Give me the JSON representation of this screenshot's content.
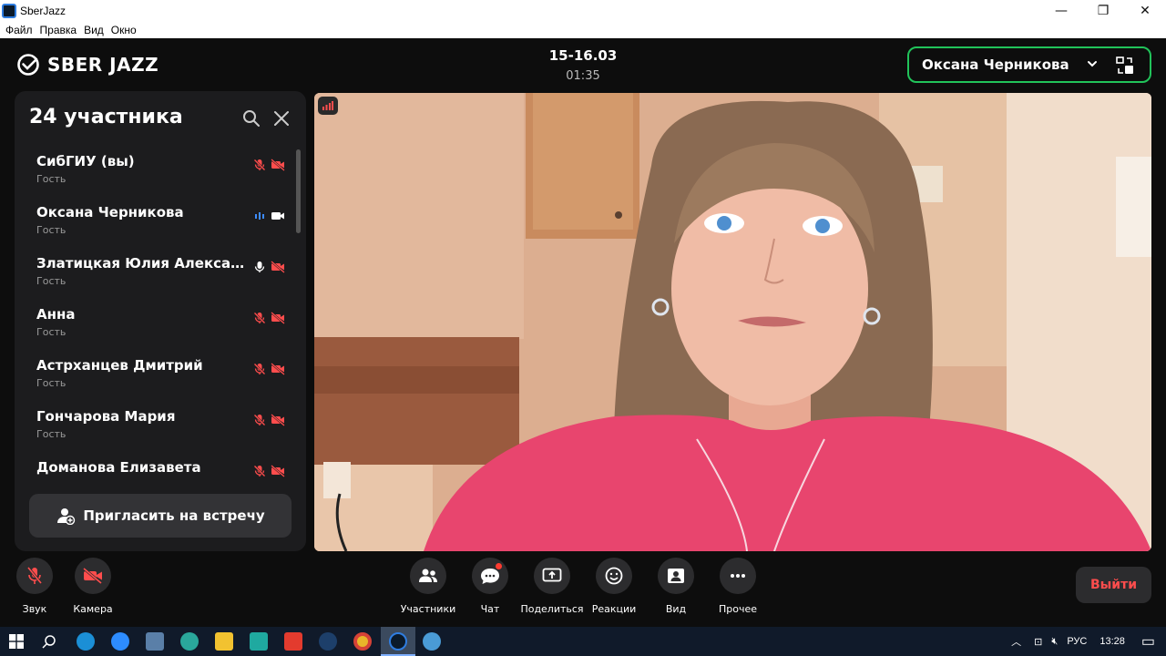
{
  "window": {
    "title": "SberJazz",
    "menu": [
      "Файл",
      "Правка",
      "Вид",
      "Окно"
    ]
  },
  "header": {
    "logo": "SBER JAZZ",
    "meeting_title": "15-16.03",
    "elapsed": "01:35",
    "active_speaker": "Оксана Черникова"
  },
  "participants_panel": {
    "title": "24 участника",
    "items": [
      {
        "name": "СибГИУ (вы)",
        "role": "Гость",
        "mic": "off",
        "cam": "off"
      },
      {
        "name": "Оксана Черникова",
        "role": "Гость",
        "mic": "speaking",
        "cam": "on"
      },
      {
        "name": "Златицкая Юлия Александровна",
        "role": "Гость",
        "mic": "on",
        "cam": "off"
      },
      {
        "name": "Анна",
        "role": "Гость",
        "mic": "off",
        "cam": "off"
      },
      {
        "name": "Астрханцев Дмитрий",
        "role": "Гость",
        "mic": "off",
        "cam": "off"
      },
      {
        "name": "Гончарова Мария",
        "role": "Гость",
        "mic": "off",
        "cam": "off"
      },
      {
        "name": "Доманова Елизавета",
        "role": "",
        "mic": "off",
        "cam": "off"
      }
    ],
    "invite_label": "Пригласить на встречу"
  },
  "controls": {
    "sound": "Звук",
    "camera": "Камера",
    "participants": "Участники",
    "chat": "Чат",
    "share": "Поделиться",
    "reactions": "Реакции",
    "view": "Вид",
    "more": "Прочее",
    "leave": "Выйти"
  },
  "taskbar": {
    "language": "РУС",
    "clock": "13:28"
  },
  "colors": {
    "accent_green": "#21c35a",
    "muted_red": "#ff4d4d",
    "speaking_blue": "#3d8bff"
  }
}
